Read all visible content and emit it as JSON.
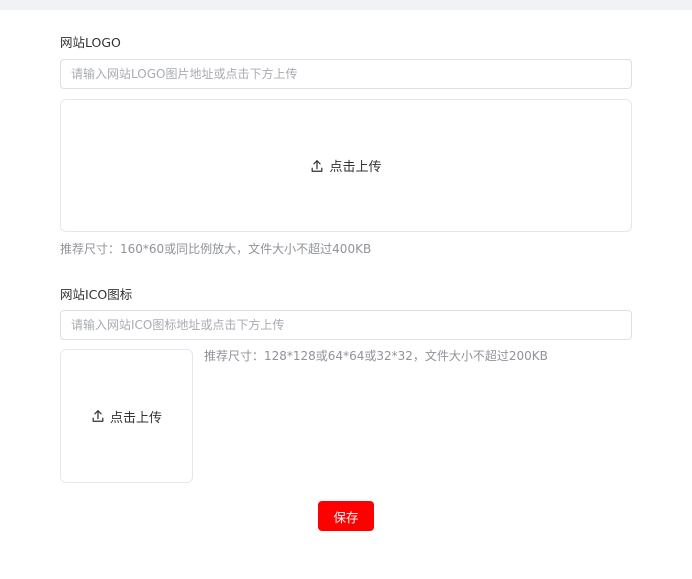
{
  "logo_section": {
    "label": "网站LOGO",
    "input_placeholder": "请输入网站LOGO图片地址或点击下方上传",
    "input_value": "",
    "upload_label": "点击上传",
    "upload_icon": "upload-icon",
    "hint": "推荐尺寸：160*60或同比例放大，文件大小不超过400KB"
  },
  "ico_section": {
    "label": "网站ICO图标",
    "input_placeholder": "请输入网站ICO图标地址或点击下方上传",
    "input_value": "",
    "upload_label": "点击上传",
    "upload_icon": "upload-icon",
    "hint": "推荐尺寸：128*128或64*64或32*32，文件大小不超过200KB"
  },
  "actions": {
    "save_label": "保存"
  },
  "colors": {
    "primary_button": "#ff0000",
    "border": "#dcdfe6",
    "hint_text": "#909399",
    "top_band": "#f0f2f5"
  }
}
